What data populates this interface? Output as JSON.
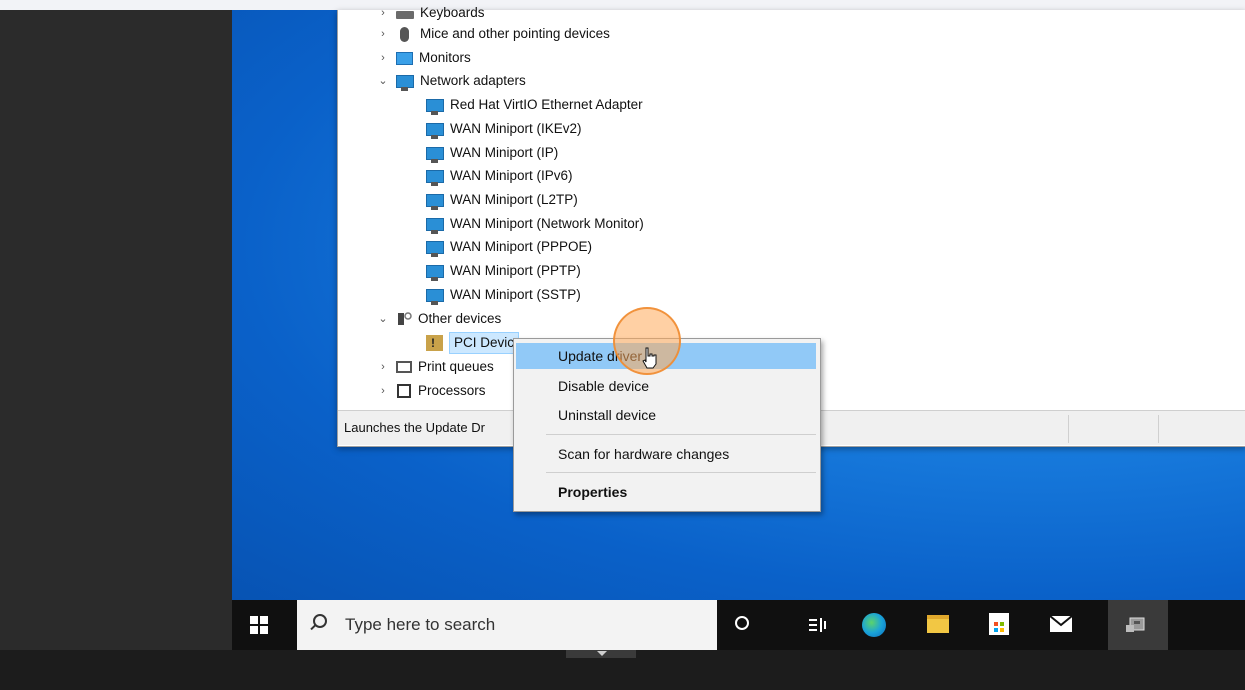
{
  "device_tree": {
    "items": [
      {
        "label": "Keyboards",
        "expander": "›",
        "icon": "keyboard-icon"
      },
      {
        "label": "Mice and other pointing devices",
        "expander": "›",
        "icon": "mouse-icon"
      },
      {
        "label": "Monitors",
        "expander": "›",
        "icon": "monitor-icon"
      },
      {
        "label": "Network adapters",
        "expander": "⌄",
        "icon": "network-adapter-icon"
      },
      {
        "label": "Red Hat VirtIO Ethernet Adapter",
        "icon": "network-adapter-icon"
      },
      {
        "label": "WAN Miniport (IKEv2)",
        "icon": "network-adapter-icon"
      },
      {
        "label": "WAN Miniport (IP)",
        "icon": "network-adapter-icon"
      },
      {
        "label": "WAN Miniport (IPv6)",
        "icon": "network-adapter-icon"
      },
      {
        "label": "WAN Miniport (L2TP)",
        "icon": "network-adapter-icon"
      },
      {
        "label": "WAN Miniport (Network Monitor)",
        "icon": "network-adapter-icon"
      },
      {
        "label": "WAN Miniport (PPPOE)",
        "icon": "network-adapter-icon"
      },
      {
        "label": "WAN Miniport (PPTP)",
        "icon": "network-adapter-icon"
      },
      {
        "label": "WAN Miniport (SSTP)",
        "icon": "network-adapter-icon"
      },
      {
        "label": "Other devices",
        "expander": "⌄",
        "icon": "other-devices-icon"
      },
      {
        "label": "PCI Devic",
        "icon": "warning-device-icon"
      },
      {
        "label": "Print queues",
        "expander": "›",
        "icon": "printer-icon"
      },
      {
        "label": "Processors",
        "expander": "›",
        "icon": "processor-icon"
      }
    ]
  },
  "status_bar": {
    "text": "Launches the Update Dr"
  },
  "context_menu": {
    "items": [
      {
        "label": "Update driver"
      },
      {
        "label": "Disable device"
      },
      {
        "label": "Uninstall device"
      },
      {
        "label": "Scan for hardware changes"
      },
      {
        "label": "Properties"
      }
    ]
  },
  "taskbar": {
    "search_placeholder": "Type here to search",
    "icons": [
      "windows-start-icon",
      "search-icon",
      "cortana-icon",
      "task-view-icon",
      "edge-icon",
      "file-explorer-icon",
      "store-icon",
      "mail-icon",
      "device-manager-icon"
    ]
  },
  "colors": {
    "desktop_blue": "#0a61c9",
    "menu_highlight": "#91c9f7",
    "cursor_halo": "#f0a050"
  }
}
